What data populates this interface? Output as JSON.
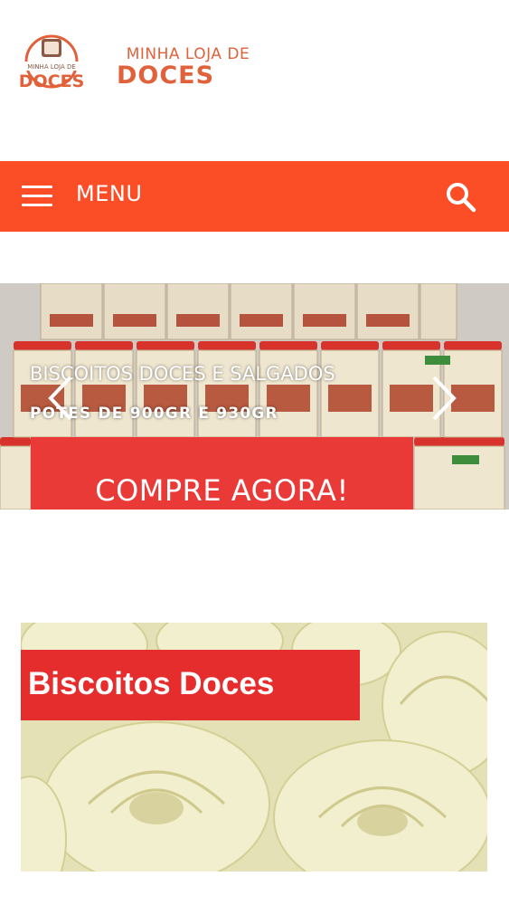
{
  "logo": {
    "badge_text_top": "MINHA LOJA DE",
    "badge_text_bottom": "DOCES",
    "line1": "MINHA LOJA DE",
    "line2": "DOCES",
    "color": "#e0613a"
  },
  "navbar": {
    "menu_label": "MENU",
    "menu_icon": "hamburger-menu-icon",
    "search_icon": "search-icon",
    "background": "#fb4e26"
  },
  "slider": {
    "title": "BISCOITOS DOCES E SALGADOS",
    "subtitle": "POTES DE 900GR E 930GR",
    "cta_label": "COMPRE AGORA!",
    "cta_color": "#ea3a38",
    "prev_icon": "chevron-left-icon",
    "next_icon": "chevron-right-icon"
  },
  "categories": [
    {
      "label": "Biscoitos Doces",
      "banner_color": "#e52d2d"
    }
  ]
}
